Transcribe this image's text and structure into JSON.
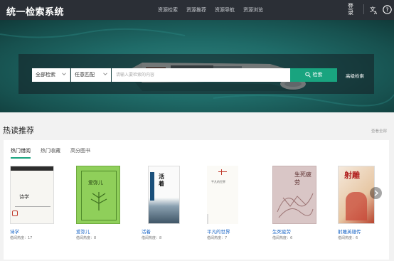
{
  "header": {
    "logo": "统一检索系统",
    "nav": [
      "资源检索",
      "资源推荐",
      "资源导航",
      "资源浏览"
    ],
    "login": "登录"
  },
  "search": {
    "scope": "全部检索",
    "match": "任意匹配",
    "placeholder": "请输入要检索的内容",
    "button": "检索",
    "advanced": "高级检索"
  },
  "recommend": {
    "title": "热读推荐",
    "view_all": "查看全部",
    "tabs": [
      "热门借阅",
      "热门收藏",
      "高分图书"
    ],
    "books": [
      {
        "title": "诗学",
        "hot": "借阅热度：17",
        "cover_text": "诗学"
      },
      {
        "title": "爱弥儿",
        "hot": "借阅热度：8",
        "cover_text": "爱弥儿"
      },
      {
        "title": "活着",
        "hot": "借阅热度：8",
        "cover_text": "活着"
      },
      {
        "title": "平凡的世界",
        "hot": "借阅热度：7",
        "cover_text": "平凡的世界"
      },
      {
        "title": "生死疲劳",
        "hot": "借阅热度：6",
        "cover_text": "生死疲劳"
      },
      {
        "title": "射雕英雄传",
        "hot": "借阅热度：6",
        "cover_text": "射雕"
      }
    ]
  },
  "colors": {
    "accent": "#19a47f",
    "topbar": "#2b2f36",
    "link": "#1a66c7"
  }
}
